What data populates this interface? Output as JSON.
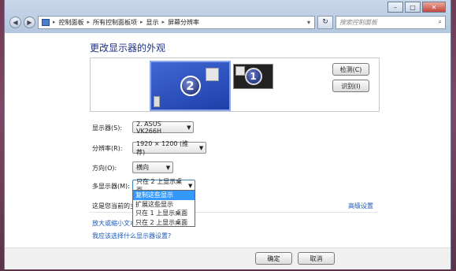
{
  "nav": {
    "breadcrumb": [
      "控制面板",
      "所有控制面板项",
      "显示",
      "屏幕分辨率"
    ],
    "search_placeholder": "搜索控制面板"
  },
  "page_title": "更改显示器的外观",
  "monitors": [
    {
      "number": "2"
    },
    {
      "number": "1"
    }
  ],
  "buttons": {
    "detect": "检测(C)",
    "identify": "识别(I)",
    "ok": "确定",
    "cancel": "取消"
  },
  "fields": {
    "display": {
      "label": "显示器(S):",
      "value": "2. ASUS VK266H"
    },
    "resolution": {
      "label": "分辨率(R):",
      "value": "1920 × 1200 (推荐)"
    },
    "orientation": {
      "label": "方向(O):",
      "value": "横向"
    },
    "multi": {
      "label": "多显示器(M):",
      "value": "只在 2 上显示桌面"
    }
  },
  "multi_options": [
    "复制这些显示",
    "扩展这些显示",
    "只在 1 上显示桌面",
    "只在 2 上显示桌面"
  ],
  "text": {
    "current_main_partial": "这是您当前的主",
    "enlarge_partial": "放大或缩小文本",
    "advanced": "高级设置",
    "which_settings": "我应该选择什么显示器设置?"
  },
  "colors": {
    "accent_blue": "#3399ff",
    "title_blue": "#1e3287",
    "link_blue": "#1e5ab8"
  },
  "icons": [
    "back-icon",
    "forward-icon",
    "control-panel-icon",
    "refresh-icon",
    "search-icon",
    "minimize-icon",
    "maximize-icon",
    "close-icon"
  ]
}
